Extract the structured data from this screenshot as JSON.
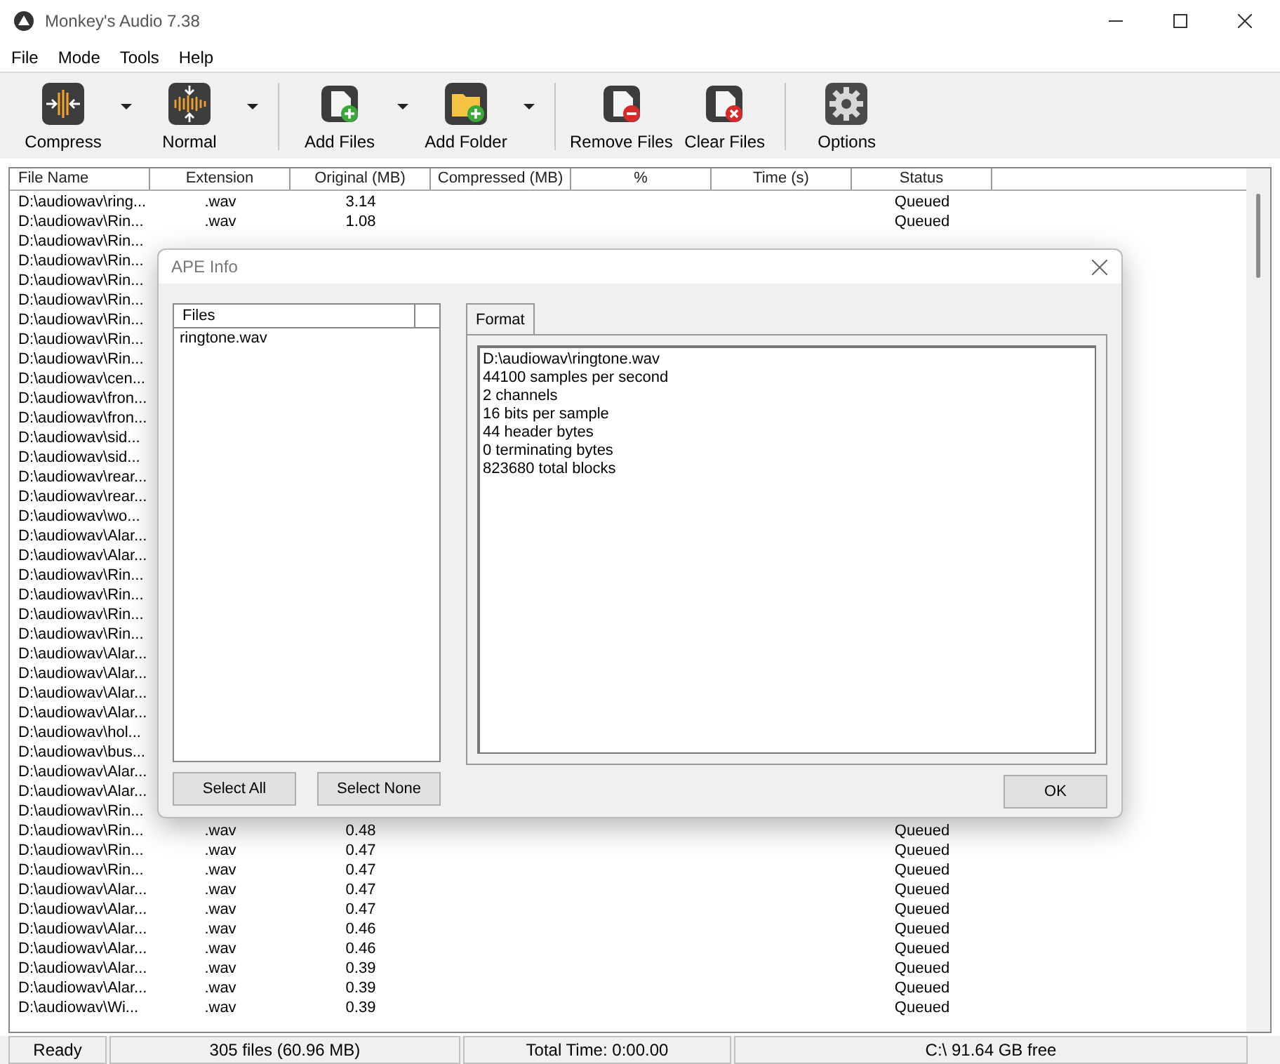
{
  "window": {
    "title": "Monkey's Audio 7.38"
  },
  "menu": [
    "File",
    "Mode",
    "Tools",
    "Help"
  ],
  "toolbar": [
    {
      "kind": "button",
      "label": "Compress",
      "dropdown": true
    },
    {
      "kind": "button",
      "label": "Normal",
      "dropdown": true
    },
    {
      "kind": "separator"
    },
    {
      "kind": "button",
      "label": "Add Files",
      "dropdown": true
    },
    {
      "kind": "button",
      "label": "Add Folder",
      "dropdown": true
    },
    {
      "kind": "separator"
    },
    {
      "kind": "button",
      "label": "Remove Files",
      "dropdown": false
    },
    {
      "kind": "button",
      "label": "Clear Files",
      "dropdown": false
    },
    {
      "kind": "separator"
    },
    {
      "kind": "button",
      "label": "Options",
      "dropdown": false
    }
  ],
  "table": {
    "columns": [
      "File Name",
      "Extension",
      "Original (MB)",
      "Compressed (MB)",
      "%",
      "Time (s)",
      "Status"
    ],
    "rows": [
      {
        "file_name": "D:\\audiowav\\ring...",
        "extension": ".wav",
        "original_mb": "3.14",
        "status": "Queued"
      },
      {
        "file_name": "D:\\audiowav\\Rin...",
        "extension": ".wav",
        "original_mb": "1.08",
        "status": "Queued"
      },
      {
        "file_name": "D:\\audiowav\\Rin..."
      },
      {
        "file_name": "D:\\audiowav\\Rin..."
      },
      {
        "file_name": "D:\\audiowav\\Rin..."
      },
      {
        "file_name": "D:\\audiowav\\Rin..."
      },
      {
        "file_name": "D:\\audiowav\\Rin..."
      },
      {
        "file_name": "D:\\audiowav\\Rin..."
      },
      {
        "file_name": "D:\\audiowav\\Rin..."
      },
      {
        "file_name": "D:\\audiowav\\cen..."
      },
      {
        "file_name": "D:\\audiowav\\fron..."
      },
      {
        "file_name": "D:\\audiowav\\fron..."
      },
      {
        "file_name": "D:\\audiowav\\sid..."
      },
      {
        "file_name": "D:\\audiowav\\sid..."
      },
      {
        "file_name": "D:\\audiowav\\rear..."
      },
      {
        "file_name": "D:\\audiowav\\rear..."
      },
      {
        "file_name": "D:\\audiowav\\wo..."
      },
      {
        "file_name": "D:\\audiowav\\Alar..."
      },
      {
        "file_name": "D:\\audiowav\\Alar..."
      },
      {
        "file_name": "D:\\audiowav\\Rin..."
      },
      {
        "file_name": "D:\\audiowav\\Rin..."
      },
      {
        "file_name": "D:\\audiowav\\Rin..."
      },
      {
        "file_name": "D:\\audiowav\\Rin..."
      },
      {
        "file_name": "D:\\audiowav\\Alar..."
      },
      {
        "file_name": "D:\\audiowav\\Alar..."
      },
      {
        "file_name": "D:\\audiowav\\Alar..."
      },
      {
        "file_name": "D:\\audiowav\\Alar..."
      },
      {
        "file_name": "D:\\audiowav\\hol..."
      },
      {
        "file_name": "D:\\audiowav\\bus..."
      },
      {
        "file_name": "D:\\audiowav\\Alar..."
      },
      {
        "file_name": "D:\\audiowav\\Alar..."
      },
      {
        "file_name": "D:\\audiowav\\Rin..."
      },
      {
        "file_name": "D:\\audiowav\\Rin...",
        "extension": ".wav",
        "original_mb": "0.48",
        "status": "Queued"
      },
      {
        "file_name": "D:\\audiowav\\Rin...",
        "extension": ".wav",
        "original_mb": "0.47",
        "status": "Queued"
      },
      {
        "file_name": "D:\\audiowav\\Rin...",
        "extension": ".wav",
        "original_mb": "0.47",
        "status": "Queued"
      },
      {
        "file_name": "D:\\audiowav\\Alar...",
        "extension": ".wav",
        "original_mb": "0.47",
        "status": "Queued"
      },
      {
        "file_name": "D:\\audiowav\\Alar...",
        "extension": ".wav",
        "original_mb": "0.47",
        "status": "Queued"
      },
      {
        "file_name": "D:\\audiowav\\Alar...",
        "extension": ".wav",
        "original_mb": "0.46",
        "status": "Queued"
      },
      {
        "file_name": "D:\\audiowav\\Alar...",
        "extension": ".wav",
        "original_mb": "0.46",
        "status": "Queued"
      },
      {
        "file_name": "D:\\audiowav\\Alar...",
        "extension": ".wav",
        "original_mb": "0.39",
        "status": "Queued"
      },
      {
        "file_name": "D:\\audiowav\\Alar...",
        "extension": ".wav",
        "original_mb": "0.39",
        "status": "Queued"
      },
      {
        "file_name": "D:\\audiowav\\Wi...",
        "extension": ".wav",
        "original_mb": "0.39",
        "status": "Queued"
      }
    ]
  },
  "status_bar": [
    "Ready",
    "305 files (60.96 MB)",
    "Total Time: 0:00.00",
    "C:\\ 91.64 GB free"
  ],
  "dialog": {
    "title": "APE Info",
    "files_header": "Files",
    "files": [
      {
        "name": "ringtone.wav"
      }
    ],
    "tabs": [
      {
        "label": "Format",
        "selected": true
      }
    ],
    "info_lines": [
      "D:\\audiowav\\ringtone.wav",
      "44100 samples per second",
      "2 channels",
      "16 bits per sample",
      "44 header bytes",
      "0 terminating bytes",
      "823680 total blocks"
    ],
    "buttons": [
      "Select All",
      "Select None"
    ],
    "ok_button": "OK"
  }
}
